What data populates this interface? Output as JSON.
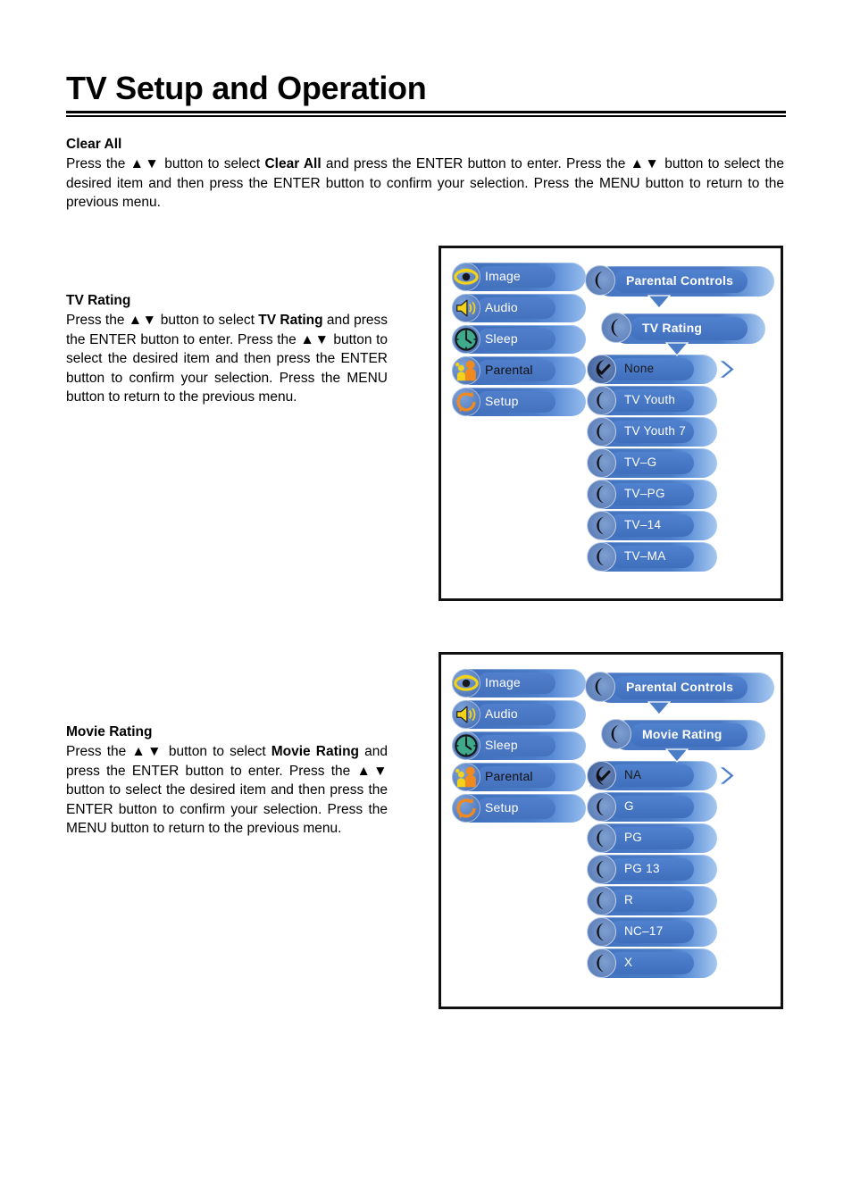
{
  "page": {
    "title": "TV Setup and Operation"
  },
  "sections": {
    "clear_all": {
      "heading": "Clear All",
      "paragraph_parts": {
        "p1": "Press the ",
        "arrows1": "▲▼",
        "p2": " button to select ",
        "bold1": "Clear All",
        "p3": " and press the ENTER button to enter. Press the ",
        "arrows2": "▲▼",
        "p4": " button to select the desired item and then press the ENTER button to confirm your selection. Press the MENU button to return to the previous menu."
      }
    },
    "tv_rating": {
      "heading": "TV Rating",
      "paragraph_parts": {
        "p1": "Press the ",
        "arrows1": "▲▼",
        "p2": " button to select ",
        "bold1": "TV  Rating",
        "p3": " and press the ENTER button to enter. Press the ",
        "arrows2": "▲▼",
        "p4": " button to select the desired item and then press the ENTER button to confirm your selection. Press the MENU button to return to the previous menu."
      }
    },
    "movie_rating": {
      "heading": "Movie Rating",
      "paragraph_parts": {
        "p1": "Press the ",
        "arrows1": "▲▼",
        "p2": " button to select ",
        "bold1": "Movie Rating",
        "p3": " and press the ENTER button to enter. Press the ",
        "arrows2": "▲▼",
        "p4": " button to select the desired item and then press the ENTER button to confirm your selection. Press the MENU button to return to the previous menu."
      }
    }
  },
  "osd_tv_rating": {
    "main_menu": [
      {
        "label": "Image",
        "icon": "eye-icon",
        "selected": false
      },
      {
        "label": "Audio",
        "icon": "speaker-icon",
        "selected": false
      },
      {
        "label": "Sleep",
        "icon": "clock-icon",
        "selected": false
      },
      {
        "label": "Parental",
        "icon": "people-icon",
        "selected": true
      },
      {
        "label": "Setup",
        "icon": "refresh-icon",
        "selected": false
      }
    ],
    "headers": [
      {
        "label": "Parental Controls",
        "icon": "crescent-icon"
      },
      {
        "label": "TV Rating",
        "icon": "crescent-icon"
      }
    ],
    "options": [
      {
        "label": "None",
        "icon": "check-icon",
        "checked": true
      },
      {
        "label": "TV Youth",
        "icon": "crescent-icon",
        "checked": false
      },
      {
        "label": "TV Youth 7",
        "icon": "crescent-icon",
        "checked": false
      },
      {
        "label": "TV–G",
        "icon": "crescent-icon",
        "checked": false
      },
      {
        "label": "TV–PG",
        "icon": "crescent-icon",
        "checked": false
      },
      {
        "label": "TV–14",
        "icon": "crescent-icon",
        "checked": false
      },
      {
        "label": "TV–MA",
        "icon": "crescent-icon",
        "checked": false
      }
    ]
  },
  "osd_movie_rating": {
    "main_menu": [
      {
        "label": "Image",
        "icon": "eye-icon",
        "selected": false
      },
      {
        "label": "Audio",
        "icon": "speaker-icon",
        "selected": false
      },
      {
        "label": "Sleep",
        "icon": "clock-icon",
        "selected": false
      },
      {
        "label": "Parental",
        "icon": "people-icon",
        "selected": true
      },
      {
        "label": "Setup",
        "icon": "refresh-icon",
        "selected": false
      }
    ],
    "headers": [
      {
        "label": "Parental Controls",
        "icon": "crescent-icon"
      },
      {
        "label": "Movie Rating",
        "icon": "crescent-icon"
      }
    ],
    "options": [
      {
        "label": "NA",
        "icon": "check-icon",
        "checked": true
      },
      {
        "label": "G",
        "icon": "crescent-icon",
        "checked": false
      },
      {
        "label": "PG",
        "icon": "crescent-icon",
        "checked": false
      },
      {
        "label": "PG 13",
        "icon": "crescent-icon",
        "checked": false
      },
      {
        "label": "R",
        "icon": "crescent-icon",
        "checked": false
      },
      {
        "label": "NC–17",
        "icon": "crescent-icon",
        "checked": false
      },
      {
        "label": "X",
        "icon": "crescent-icon",
        "checked": false
      }
    ]
  },
  "colors": {
    "osd_pill_blue": "#4a7cc8",
    "osd_pill_light": "#a6c8f0",
    "icon_yellow": "#f2d21b",
    "icon_orange": "#f08a1e",
    "icon_teal": "#3fa98c",
    "text_white": "#ffffff",
    "frame_black": "#111111"
  }
}
